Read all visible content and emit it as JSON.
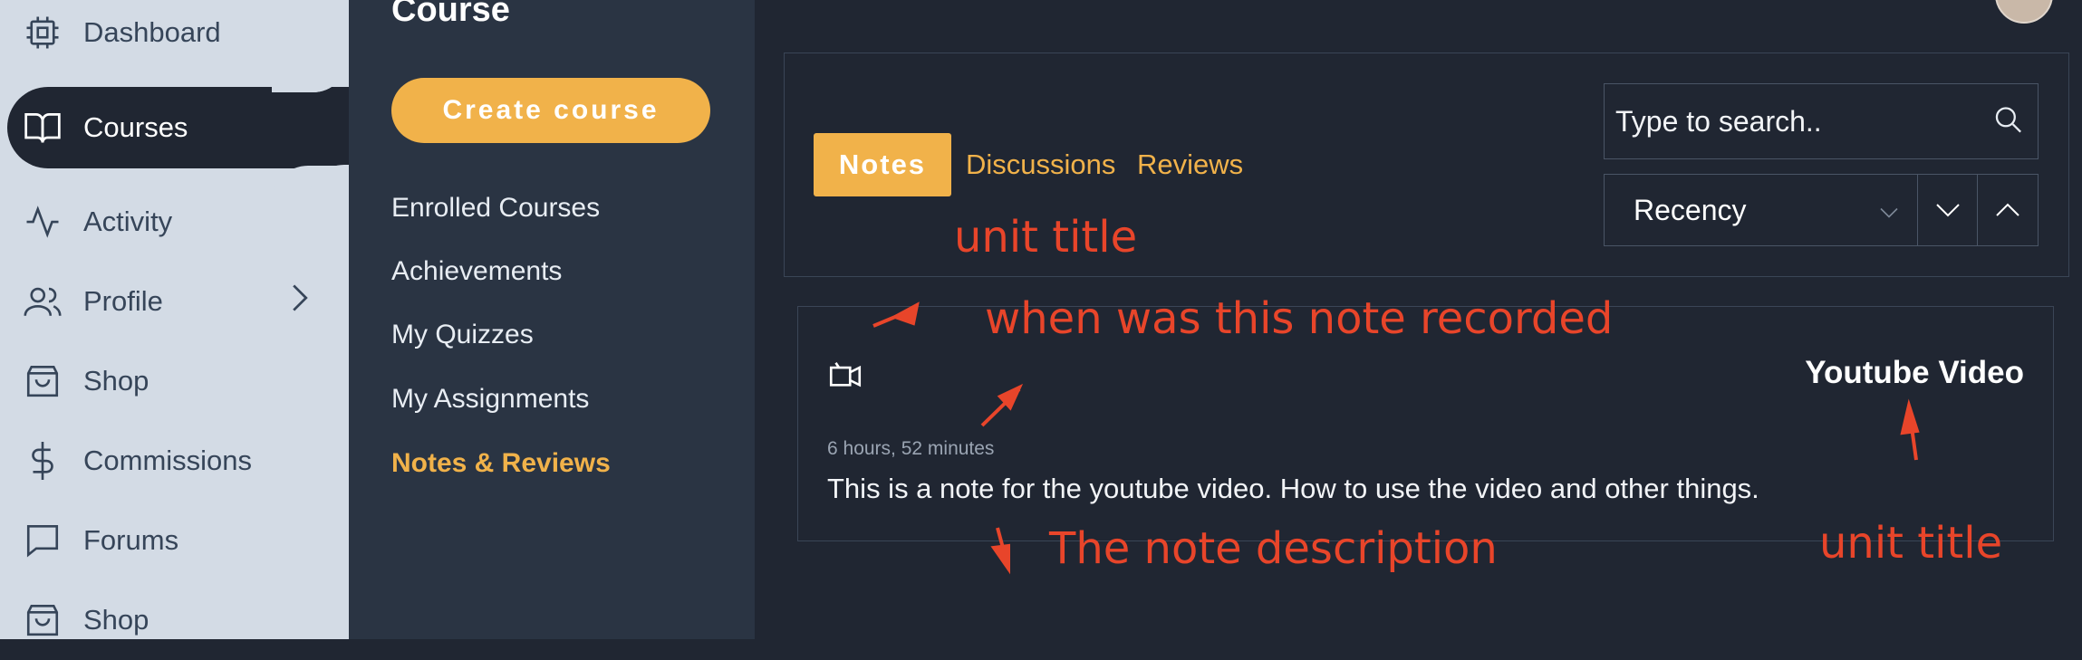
{
  "sidebar": {
    "items": [
      {
        "label": "Dashboard",
        "icon": "cpu-icon"
      },
      {
        "label": "Courses",
        "icon": "book-open-icon"
      },
      {
        "label": "Activity",
        "icon": "activity-icon"
      },
      {
        "label": "Profile",
        "icon": "users-icon"
      },
      {
        "label": "Shop",
        "icon": "shopping-bag-icon"
      },
      {
        "label": "Commissions",
        "icon": "dollar-icon"
      },
      {
        "label": "Forums",
        "icon": "message-square-icon"
      },
      {
        "label": "Shop",
        "icon": "shopping-bag-icon"
      }
    ]
  },
  "course_menu": {
    "title": "Course",
    "create_label": "Create course",
    "items": [
      "Enrolled Courses",
      "Achievements",
      "My Quizzes",
      "My Assignments",
      "Notes & Reviews"
    ]
  },
  "tabs": [
    "Notes",
    "Discussions",
    "Reviews"
  ],
  "search": {
    "placeholder": "Type to search.."
  },
  "sort": {
    "selected": "Recency"
  },
  "note": {
    "unit_title": "Youtube Video",
    "time": "6 hours, 52 minutes",
    "description": "This is a note for the youtube video. How to use the video and other things."
  },
  "annotations": {
    "unit_title_top": "unit title",
    "recorded": "when was this note recorded",
    "description": "The note description",
    "unit_title_bottom": "unit title"
  },
  "colors": {
    "accent": "#f1b24a",
    "annotation": "#e8452a",
    "dark_bg": "#202632",
    "sidebar_bg": "#d3dbe5"
  }
}
